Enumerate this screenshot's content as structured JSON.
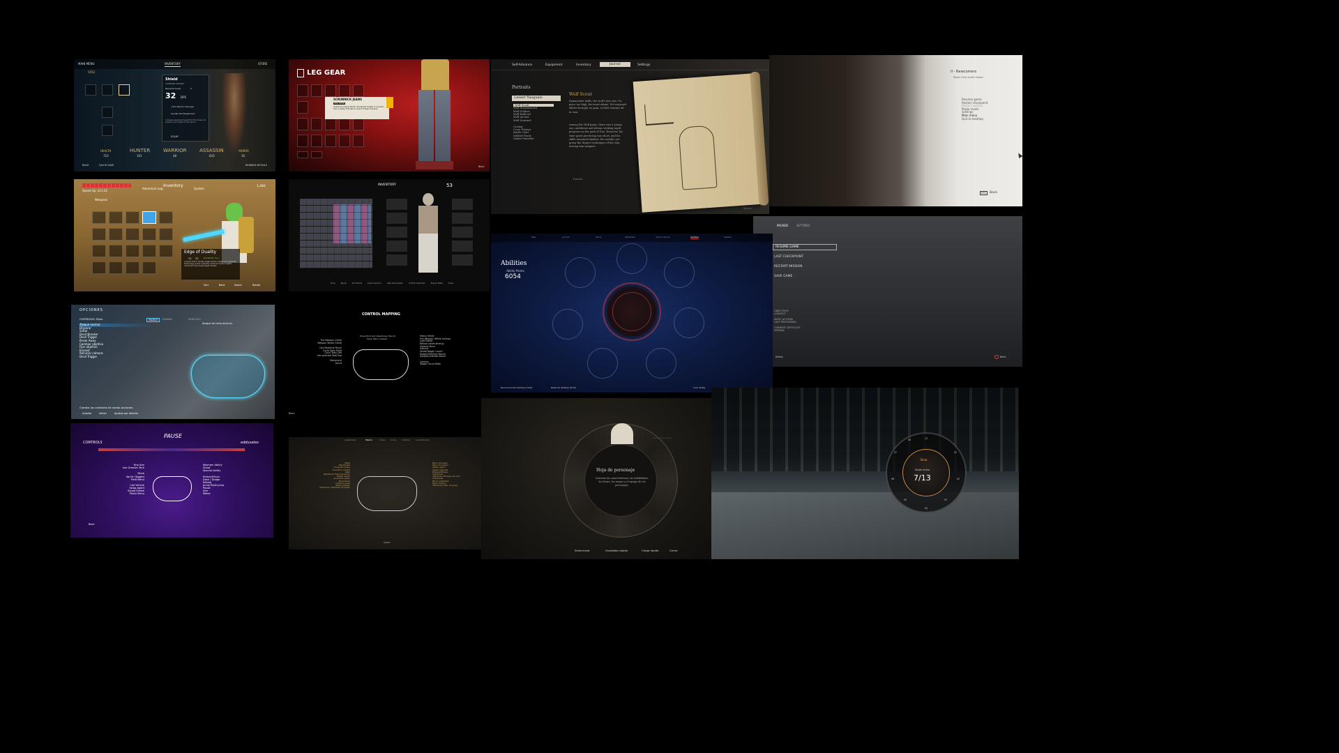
{
  "t1": {
    "nav_left": "MAIN MENU",
    "nav_right": "STORE",
    "tabs": [
      "",
      "INVENTORY",
      "",
      ""
    ],
    "money": "5952",
    "counts": [
      "12",
      "14",
      "0",
      "14",
      "14",
      "86"
    ],
    "item_name": "Shield",
    "item_type": "COMMON SWORD",
    "required_level": "Required Level",
    "level": "5",
    "dps": "32",
    "dps_label": "DPS",
    "perk1": "+5% Warrior Damage",
    "perk2": "Sandal Slot Equipment",
    "desc": "Increase equipment level from the forge and enhance your stats for this sword.",
    "equip": "EQUIP",
    "stats": [
      {
        "label": "HEALTH",
        "value": "723"
      },
      {
        "label": "HUNTER",
        "sub": "DAMAGE",
        "value": "101"
      },
      {
        "label": "WARRIOR",
        "sub": "DAMAGE",
        "value": "48"
      },
      {
        "label": "ASSASSIN",
        "sub": "DAMAGE",
        "value": "643"
      },
      {
        "label": "ARMOR",
        "value": "16"
      }
    ],
    "footer_back": "BACK",
    "footer_quick": "QUICK SAVE",
    "footer_right": "REWARD DETAILS"
  },
  "t2": {
    "title": "LEG GEAR",
    "item_title": "SCRUBNICK JEANS",
    "item_tag": "LEG GEAR",
    "item_desc": "Grants Scumbling Points. Triumphed Hustler is a portion from a Camp Fire Allie on Grant to Near Enemies.",
    "back": "Back"
  },
  "t3": {
    "tabs": [
      "Self-Advance",
      "Equipment",
      "Inventory",
      "Journal",
      "Settings"
    ],
    "section": "Portraits",
    "selected": "Lesser Yaoguais",
    "list": [
      "Wolf Scout",
      "Wolf Swornsword",
      "Wolf Soldier",
      "Wolf Bullcart",
      "Wolf Archer",
      "Wolf Sentinel",
      "",
      "Crooky",
      "Crow Diviner",
      "Rattle Clad",
      "Melted Studs",
      "Snake Patroller"
    ],
    "entry_title": "Wolf Scout",
    "entry_p1": "Immaculate skills, the wolf's last sins. No price too high, his heart afame. Yet wayward efforts brought no gain. A futile venture all in vain.",
    "entry_p2": "Among the Wolf guais, there was a young one, ambitious and always seeking rapid progress on the path of Dao. However, his time spent practicing was short, and his skills remained shallow. He couldn't yet grasp the deeper techniques of his clan, leaving him inexpert.",
    "expand": "Expand",
    "return": "Return"
  },
  "t4": {
    "chapter": "II - Newcomers",
    "objective": "Reach the south tower",
    "menu": [
      "Resume game",
      "Restart checkpoint",
      "Restart section",
      "Photo mode",
      "Settings",
      "Main menu",
      "Quit to desktop"
    ],
    "back_key": "ESC",
    "back": "Back"
  },
  "t5": {
    "speed": "Speed Up: $11:32",
    "tab_left": "Adventure Log",
    "tab_mid": "Inventory",
    "tab_right": "System",
    "rupees": "1,484",
    "category": "Weapons",
    "weapon_name": "Edge of Duality",
    "stat_a": "20",
    "stat_b": "30",
    "durability": "Durability Up +",
    "weapon_desc": "A sword with a double-edged blade crafted using Sheikah technology. It was originally made for Hylian knights unfamiliar with single-edged blades.",
    "footer": [
      "Sort",
      "Back",
      "Select",
      "Rotate"
    ]
  },
  "t6": {
    "top_left": "INVENTORY",
    "weight": "53",
    "footer": [
      "Drop",
      "Equip",
      "Sort Items",
      "Jump Sections",
      "Item Description",
      "Unfold Character",
      "Player Stats",
      "Close"
    ]
  },
  "t7": {
    "title": "Resume Game",
    "paused": "PAUSED",
    "settings": "SETTINGS",
    "menu": [
      "RESUME GAME",
      "LAST CHECKPOINT",
      "RESTART MISSION",
      "SAVE GAME"
    ],
    "info": [
      "OBJECTIVES",
      "LOADOUT",
      "",
      "ANTIC ACTIONS",
      "LAST PERFORMED",
      "",
      "CURRENT DIFFICULTY",
      "NORMAL"
    ],
    "select": "Select",
    "back": "Back"
  },
  "t8": {
    "title": "OPCIONES",
    "sub_left": "CONTROLES: DUAL",
    "tabs": [
      "MANDO",
      "CAMARA",
      "VEHICULO"
    ],
    "hint": "Ataque de corto alcance.",
    "items": [
      "Ataque normal",
      "Disparar",
      "Soltar",
      "Devil Breaker",
      "Devil Trigger",
      "Break Away",
      "Cambiar objetivo",
      "Fijar objetivo",
      "Exceed",
      "Reiniciar cámara",
      "Devil Trigger"
    ],
    "footer_text": "Cambia los controles de varias acciones.",
    "footer_buttons": [
      "Aceptar",
      "Volver",
      "Ajustes por defecto"
    ]
  },
  "t9": {
    "title": "CONTROL MAPPING",
    "left": [
      "Fire Weapon (Hold)",
      "Weapon Wheel (Hold)",
      "",
      "Use Medicine Pouch",
      "Cycle Tools Right",
      "Cycle Tools Left",
      "Use selected Tool/Trap",
      "",
      "Movement",
      "Sprint"
    ],
    "top": [
      "Show HUD and Objectives (Touch)",
      "Open Menu (Swipe)"
    ],
    "right": [
      "Heavy Melee",
      "Fire Weapon (While aiming)",
      "Light Melee",
      "Reload (while aiming)",
      "Options Menu",
      "Interact",
      "Strike/Toggle Crouch",
      "Dodge Roll/Slow Mount",
      "Jump/Accelerate Mount",
      "",
      "Camera",
      "Toggle Focus Mode"
    ],
    "back": "Back"
  },
  "t10": {
    "tabs": [
      "Map",
      "Journal",
      "Items",
      "Attributes",
      "Gear & Stores",
      "Abilities",
      "System"
    ],
    "title": "Abilities",
    "points_label": "Ability Points",
    "points": "6054",
    "footer": [
      "Recommended Abilities (Hold)",
      "Reset All Abilities (Hold)",
      "Look Ability"
    ]
  },
  "t11": {
    "title": "PAUSE",
    "section": "CONTROLS",
    "player": "eddusates",
    "left": [
      "Fine Aim",
      "Use Gremlin Tech",
      "",
      "Move",
      "Sprint (Toggle)",
      "Field Menu",
      "",
      "Call Vehicle",
      "Swap Agent",
      "Squad Emote",
      "Photo Menu"
    ],
    "right": [
      "Mayhem Ability",
      "Shoot",
      "Special Ability",
      "",
      "Interact/Scan",
      "Dash / Dodge",
      "Reload",
      "Jump/Triple Jump",
      "Pause",
      "Aim",
      "Melee"
    ],
    "back": "Back"
  },
  "t12": {
    "tabs": [
      "Jugabilidad",
      "Mando",
      "Vídeo",
      "Audio",
      "Interfaz",
      "Accesibilidad"
    ],
    "left": [
      "Mapa",
      "Habilidades",
      "Comandar grupo",
      "Inventario (d-pad)",
      "Salto",
      "(Mantener) Esquivar/Correr",
      "Objeto rápido",
      "Guardado rápido",
      "Esconderse",
      "Cambiar grupo",
      "Ataque pesado",
      "(Mantener) Habilidad de objeto"
    ],
    "right": [
      "Menú del juego",
      "Menú de equipo",
      "Ataque ligero",
      "Ataque especial",
      "Bloqueo/Parada",
      "Interactuar",
      "(Mantener) Bloqueo de mira",
      "Interactuar",
      "Menú contextual",
      "Modo cámara",
      "(Mantener) Hab. de grupo"
    ],
    "close": "Cerrar"
  },
  "t13": {
    "center_title": "Hoja de personaje",
    "center_desc": "Gestiona las características, las habilidades, los dones, los rasgos y el equipo de tus personajes.",
    "footer": [
      "Seleccionar",
      "Guardado rápido",
      "Carga rápida",
      "Cerrar"
    ],
    "side_hint": "Hoja de personaje"
  },
  "t14": {
    "weapon": "Bow",
    "ammo_type": "Steak Arrow",
    "ammo": "7/13",
    "slots": [
      "13",
      "01",
      "02",
      "03",
      "04",
      "05",
      "06",
      "07",
      "08"
    ]
  }
}
